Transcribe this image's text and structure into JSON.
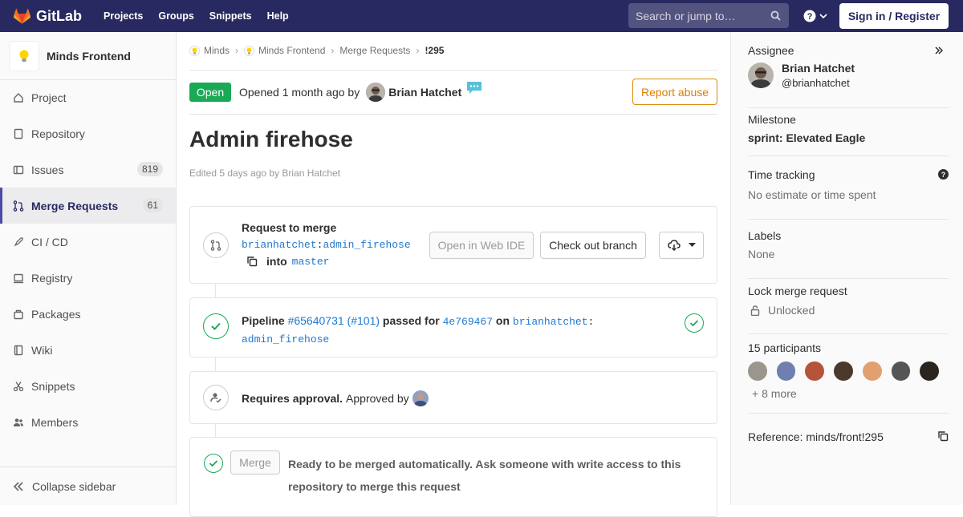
{
  "topnav": {
    "brand": "GitLab",
    "links": [
      "Projects",
      "Groups",
      "Snippets",
      "Help"
    ],
    "search_placeholder": "Search or jump to…",
    "signin_label": "Sign in / Register"
  },
  "sidebar": {
    "project_name": "Minds Frontend",
    "items": [
      {
        "label": "Project",
        "icon": "home-icon"
      },
      {
        "label": "Repository",
        "icon": "doc-icon"
      },
      {
        "label": "Issues",
        "icon": "issues-icon",
        "badge": "819"
      },
      {
        "label": "Merge Requests",
        "icon": "merge-request-icon",
        "badge": "61",
        "active": true
      },
      {
        "label": "CI / CD",
        "icon": "rocket-icon"
      },
      {
        "label": "Registry",
        "icon": "container-icon"
      },
      {
        "label": "Packages",
        "icon": "package-icon"
      },
      {
        "label": "Wiki",
        "icon": "book-icon"
      },
      {
        "label": "Snippets",
        "icon": "scissors-icon"
      },
      {
        "label": "Members",
        "icon": "users-icon"
      }
    ],
    "collapse_label": "Collapse sidebar"
  },
  "breadcrumb": {
    "items": [
      "Minds",
      "Minds Frontend",
      "Merge Requests",
      "!295"
    ]
  },
  "header": {
    "status": "Open",
    "opened_text": "Opened 1 month ago by",
    "author": "Brian Hatchet",
    "report_label": "Report abuse"
  },
  "mr": {
    "title": "Admin firehose",
    "edited": "Edited 5 days ago by Brian Hatchet"
  },
  "request_card": {
    "heading": "Request to merge",
    "source_user": "brianhatchet",
    "source_branch": "admin_firehose",
    "into_label": "into",
    "target_branch": "master",
    "web_ide_label": "Open in Web IDE",
    "checkout_label": "Check out branch"
  },
  "pipeline_card": {
    "label": "Pipeline",
    "pipeline_id": "#65640731",
    "pipeline_iid": "(#101)",
    "passed_for": "passed for",
    "commit": "4e769467",
    "on_label": "on",
    "branch_user": "brianhatchet",
    "branch_name": "admin_firehose"
  },
  "approval_card": {
    "requires": "Requires approval.",
    "approved_by": "Approved by"
  },
  "merge_card": {
    "merge_label": "Merge",
    "message_line1": "Ready to be merged automatically. Ask someone with write access to this",
    "message_line2": "repository to merge this request"
  },
  "right_sidebar": {
    "assignee_title": "Assignee",
    "assignee_name": "Brian Hatchet",
    "assignee_handle": "@brianhatchet",
    "milestone_title": "Milestone",
    "milestone_value": "sprint: Elevated Eagle",
    "time_title": "Time tracking",
    "time_value": "No estimate or time spent",
    "labels_title": "Labels",
    "labels_value": "None",
    "lock_title": "Lock merge request",
    "lock_value": "Unlocked",
    "participants_title": "15 participants",
    "more_label": "+ 8 more",
    "reference": "Reference: minds/front!295"
  },
  "colors": {
    "nav": "#292961",
    "open_badge": "#1aaa55",
    "link": "#1f78d1",
    "report": "#de7e00"
  }
}
